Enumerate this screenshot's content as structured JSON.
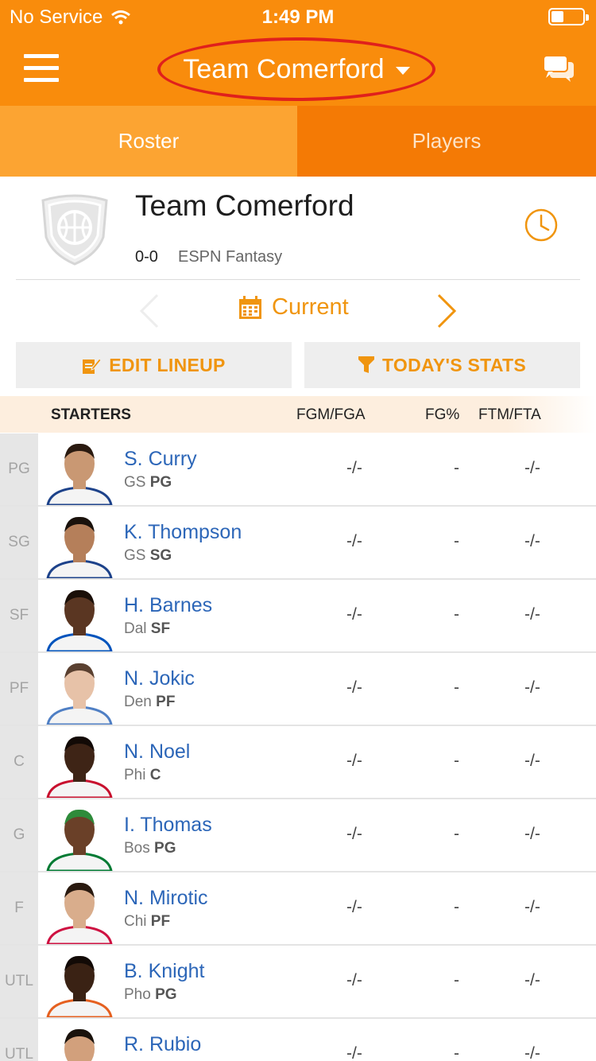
{
  "status_bar": {
    "carrier": "No Service",
    "time": "1:49 PM",
    "battery_level": 0.4
  },
  "header": {
    "team_selector": "Team Comerford",
    "menu_icon": "hamburger-menu-icon",
    "chat_icon": "chat-bubbles-icon",
    "colors": {
      "brand": "#f98c0c",
      "highlight": "#e0201c"
    }
  },
  "tabs": [
    {
      "label": "Roster",
      "active": true
    },
    {
      "label": "Players",
      "active": false
    }
  ],
  "team": {
    "name": "Team Comerford",
    "record": "0-0",
    "league": "ESPN Fantasy"
  },
  "period": {
    "label": "Current"
  },
  "actions": {
    "edit_lineup": "EDIT LINEUP",
    "todays_stats": "TODAY'S STATS"
  },
  "table": {
    "section": "STARTERS",
    "columns": [
      "FGM/FGA",
      "FG%",
      "FTM/FTA"
    ],
    "rows": [
      {
        "slot": "PG",
        "name": "S. Curry",
        "team": "GS",
        "pos": "PG",
        "fgm_fga": "-/-",
        "fg_pct": "-",
        "ftm_fta": "-/-",
        "skin": "#c99873",
        "hair": "#2a1a10",
        "jersey": "#f4f4f4",
        "trim": "#1d428a"
      },
      {
        "slot": "SG",
        "name": "K. Thompson",
        "team": "GS",
        "pos": "SG",
        "fgm_fga": "-/-",
        "fg_pct": "-",
        "ftm_fta": "-/-",
        "skin": "#b57f5a",
        "hair": "#1a120c",
        "jersey": "#f4f4f4",
        "trim": "#1d428a"
      },
      {
        "slot": "SF",
        "name": "H. Barnes",
        "team": "Dal",
        "pos": "SF",
        "fgm_fga": "-/-",
        "fg_pct": "-",
        "ftm_fta": "-/-",
        "skin": "#5a3622",
        "hair": "#1a0f08",
        "jersey": "#f4f4f4",
        "trim": "#0053bc"
      },
      {
        "slot": "PF",
        "name": "N. Jokic",
        "team": "Den",
        "pos": "PF",
        "fgm_fga": "-/-",
        "fg_pct": "-",
        "ftm_fta": "-/-",
        "skin": "#e7c2a8",
        "hair": "#5a4030",
        "jersey": "#f4f4f4",
        "trim": "#4f7fc4"
      },
      {
        "slot": "C",
        "name": "N. Noel",
        "team": "Phi",
        "pos": "C",
        "fgm_fga": "-/-",
        "fg_pct": "-",
        "ftm_fta": "-/-",
        "skin": "#3e2416",
        "hair": "#120a06",
        "jersey": "#f4f4f4",
        "trim": "#c8102e"
      },
      {
        "slot": "G",
        "name": "I. Thomas",
        "team": "Bos",
        "pos": "PG",
        "fgm_fga": "-/-",
        "fg_pct": "-",
        "ftm_fta": "-/-",
        "skin": "#6a4028",
        "hair": "#2e8b3a",
        "jersey": "#f4f4f4",
        "trim": "#007a33"
      },
      {
        "slot": "F",
        "name": "N. Mirotic",
        "team": "Chi",
        "pos": "PF",
        "fgm_fga": "-/-",
        "fg_pct": "-",
        "ftm_fta": "-/-",
        "skin": "#d9ad8c",
        "hair": "#2a1a10",
        "jersey": "#f4f4f4",
        "trim": "#ce1141"
      },
      {
        "slot": "UTL",
        "name": "B. Knight",
        "team": "Pho",
        "pos": "PG",
        "fgm_fga": "-/-",
        "fg_pct": "-",
        "ftm_fta": "-/-",
        "skin": "#3a2214",
        "hair": "#120a06",
        "jersey": "#f4f4f4",
        "trim": "#e56020"
      },
      {
        "slot": "UTL",
        "name": "R. Rubio",
        "team": "",
        "pos": "",
        "fgm_fga": "-/-",
        "fg_pct": "-",
        "ftm_fta": "-/-",
        "skin": "#d2a07c",
        "hair": "#1a120c",
        "jersey": "#f4f4f4",
        "trim": "#236192"
      }
    ]
  }
}
